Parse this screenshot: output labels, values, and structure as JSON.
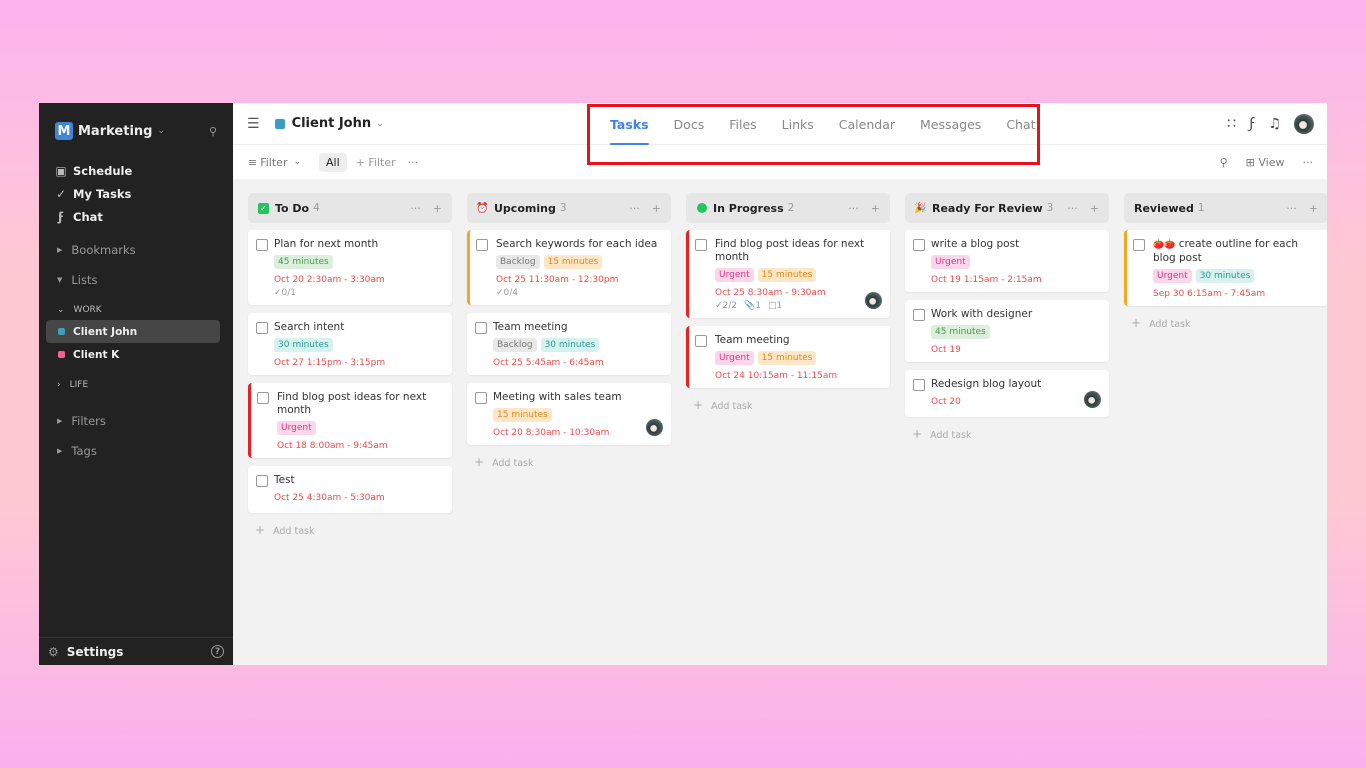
{
  "sidebar": {
    "workspace": {
      "logo_letter": "M",
      "name": "Marketing"
    },
    "nav": [
      {
        "label": "Schedule",
        "icon": "calendar-icon"
      },
      {
        "label": "My Tasks",
        "icon": "check-circle-icon"
      },
      {
        "label": "Chat",
        "icon": "bolt-icon"
      }
    ],
    "sections": {
      "bookmarks": "Bookmarks",
      "lists": "Lists",
      "filters": "Filters",
      "tags": "Tags"
    },
    "groups": {
      "work": "WORK",
      "life": "LIFE"
    },
    "lists": [
      {
        "label": "Client John",
        "color": "#3a9dc1",
        "active": true
      },
      {
        "label": "Client K",
        "color": "#f06292",
        "active": false
      }
    ],
    "settings_label": "Settings"
  },
  "header": {
    "project_name": "Client John",
    "project_color": "#3a9dc1",
    "tabs": [
      "Tasks",
      "Docs",
      "Files",
      "Links",
      "Calendar",
      "Messages",
      "Chat"
    ],
    "active_tab": "Tasks"
  },
  "filterbar": {
    "filter_label": "Filter",
    "all_label": "All",
    "add_filter_label": "+ Filter",
    "view_label": "View"
  },
  "board": {
    "add_task_label": "Add task",
    "columns": [
      {
        "title": "To Do",
        "count": "4",
        "icon": "checkbox-icon",
        "cards": [
          {
            "title": "Plan for next month",
            "tags": [
              {
                "text": "45 minutes",
                "style": "green"
              }
            ],
            "date": "Oct 20 2:30am - 3:30am",
            "subtasks": "0/1"
          },
          {
            "title": "Search intent",
            "tags": [
              {
                "text": "30 minutes",
                "style": "teal"
              }
            ],
            "date": "Oct 27 1:15pm - 3:15pm"
          },
          {
            "title": "Find blog post ideas for next month",
            "border": "red",
            "tags": [
              {
                "text": "Urgent",
                "style": "pink"
              }
            ],
            "date": "Oct 18 8:00am - 9:45am"
          },
          {
            "title": "Test",
            "tags": [],
            "date": "Oct 25 4:30am - 5:30am"
          }
        ]
      },
      {
        "title": "Upcoming",
        "count": "3",
        "icon": "alarm-clock-icon",
        "cards": [
          {
            "title": "Search keywords for each idea",
            "border": "orange",
            "tags": [
              {
                "text": "Backlog",
                "style": "gray"
              },
              {
                "text": "15 minutes",
                "style": "orange"
              }
            ],
            "date": "Oct 25 11:30am - 12:30pm",
            "subtasks": "0/4"
          },
          {
            "title": "Team meeting",
            "tags": [
              {
                "text": "Backlog",
                "style": "gray"
              },
              {
                "text": "30 minutes",
                "style": "teal"
              }
            ],
            "date": "Oct 25 5:45am - 6:45am"
          },
          {
            "title": "Meeting with sales team",
            "tags": [
              {
                "text": "15 minutes",
                "style": "orange"
              }
            ],
            "date": "Oct 20 8:30am - 10:30am",
            "avatar": true
          }
        ]
      },
      {
        "title": "In Progress",
        "count": "2",
        "icon": "green-dot-icon",
        "cards": [
          {
            "title": "Find blog post ideas for next month",
            "border": "red",
            "tags": [
              {
                "text": "Urgent",
                "style": "pink"
              },
              {
                "text": "15 minutes",
                "style": "orange"
              }
            ],
            "date": "Oct 25 8:30am - 9:30am",
            "subtasks": "2/2",
            "attachments": "1",
            "comments": "1",
            "avatar": true
          },
          {
            "title": "Team meeting",
            "border": "red",
            "tags": [
              {
                "text": "Urgent",
                "style": "pink"
              },
              {
                "text": "15 minutes",
                "style": "orange"
              }
            ],
            "date": "Oct 24 10:15am - 11:15am"
          }
        ]
      },
      {
        "title": "Ready For Review",
        "count": "3",
        "icon": "party-popper-icon",
        "cards": [
          {
            "title": "write a blog post",
            "tags": [
              {
                "text": "Urgent",
                "style": "pink"
              }
            ],
            "date": "Oct 19 1:15am - 2:15am"
          },
          {
            "title": "Work with designer",
            "tags": [
              {
                "text": "45 minutes",
                "style": "green"
              }
            ],
            "date": "Oct 19"
          },
          {
            "title": "Redesign blog layout",
            "tags": [],
            "date": "Oct 20",
            "avatar": true
          }
        ]
      },
      {
        "title": "Reviewed",
        "count": "1",
        "icon": "",
        "cards": [
          {
            "title": "create outline for each blog post",
            "prefix": "🍅🍅",
            "border": "orange",
            "tags": [
              {
                "text": "Urgent",
                "style": "pink"
              },
              {
                "text": "30 minutes",
                "style": "teal"
              }
            ],
            "date": "Sep 30 6:15am - 7:45am"
          }
        ]
      }
    ]
  }
}
